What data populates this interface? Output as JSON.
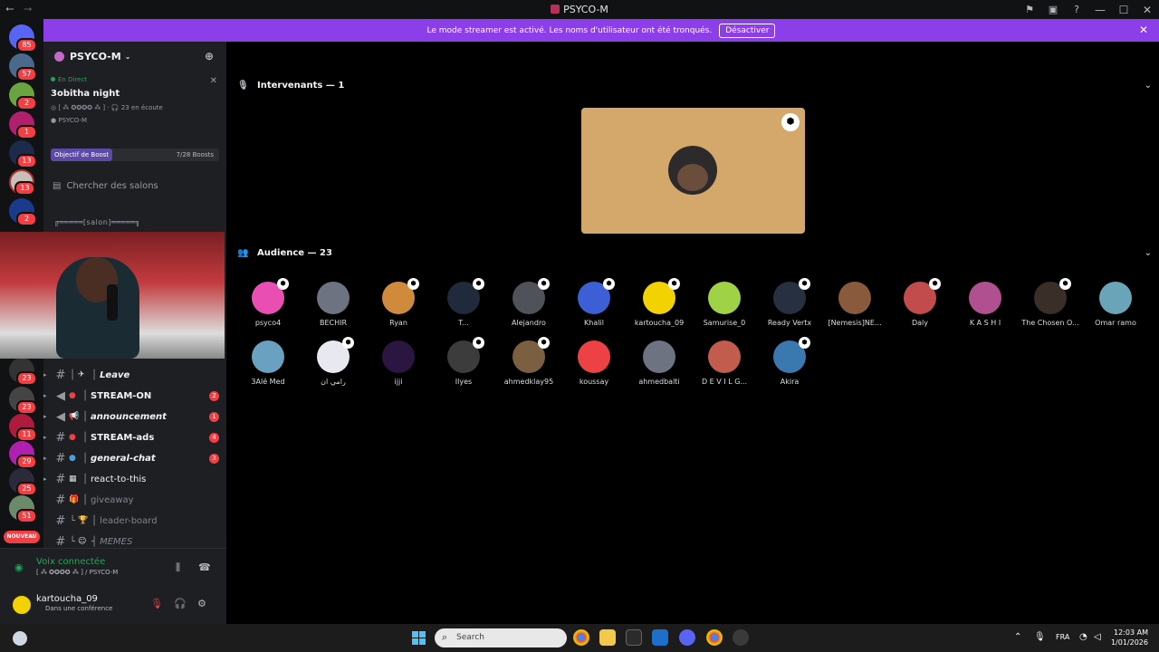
{
  "titlebar": {
    "title": "PSYCO-M",
    "back_icon": "arrow-left-icon",
    "forward_icon": "arrow-right-icon"
  },
  "streamer_banner": {
    "message": "Le mode streamer est activé. Les noms d'utilisateur ont été tronqués.",
    "button": "Désactiver"
  },
  "server_badges": [
    "85",
    "57",
    "2",
    "1",
    "13",
    "13",
    "2",
    "23",
    "23",
    "11",
    "29",
    "25",
    "51"
  ],
  "server_new_label": "NOUVEAU",
  "guild": {
    "name": "PSYCO-M",
    "live_label": "En Direct",
    "stage_title": "3obitha night",
    "stage_channel": "[ ⁂ ✪✪✪✪ ⁂ ]",
    "listeners": "23 en écoute",
    "host": "PSYCO-M",
    "boost_goal": "Objectif de Boost",
    "boost_count": "7/28 Boosts",
    "search_placeholder": "Chercher des salons",
    "category": "╔═════[salon]═════╗"
  },
  "channels": [
    {
      "emoji": "✈",
      "name": "Leave",
      "badge": "",
      "style": "bold-italic"
    },
    {
      "emoji": "●",
      "name": "STREAM-ON",
      "badge": "2",
      "style": "bold"
    },
    {
      "emoji": "📢",
      "name": "announcement",
      "badge": "1",
      "style": "italic"
    },
    {
      "emoji": "●",
      "name": "STREAM-ads",
      "badge": "4",
      "style": "bold"
    },
    {
      "emoji": "●",
      "name": "general-chat",
      "badge": "3",
      "style": "italic"
    },
    {
      "emoji": "▦",
      "name": "react-to-this",
      "badge": "",
      "style": "plain"
    },
    {
      "emoji": "🎁",
      "name": "giveaway",
      "badge": "",
      "style": "dim"
    },
    {
      "emoji": "🏆",
      "name": "leader-board",
      "badge": "",
      "style": "dim"
    },
    {
      "emoji": "☺",
      "name": "MEMES",
      "badge": "",
      "style": "dim"
    }
  ],
  "voice": {
    "status": "Voix connectée",
    "location": "[ ⁂ ✪✪✪✪ ⁂ ] / PSYCO-M"
  },
  "user": {
    "name": "kartoucha_09",
    "status": "Dans une conférence"
  },
  "stage": {
    "speakers_label": "Intervenants — 1",
    "audience_label": "Audience — 23"
  },
  "audience": [
    {
      "name": "psyco4",
      "color": "#e94fb3",
      "mod": true
    },
    {
      "name": "BECHIR",
      "color": "#6d7380",
      "mod": false
    },
    {
      "name": "Ryan",
      "color": "#d08a3c",
      "mod": true
    },
    {
      "name": "T...",
      "color": "#1f2a3c",
      "mod": true
    },
    {
      "name": "Alejandro",
      "color": "#4f5258",
      "mod": true
    },
    {
      "name": "Khalil",
      "color": "#3d5fd6",
      "mod": true
    },
    {
      "name": "kartoucha_09",
      "color": "#f2d200",
      "mod": true
    },
    {
      "name": "Samurise_0",
      "color": "#9fd245",
      "mod": false
    },
    {
      "name": "Ready Vertx",
      "color": "#263040",
      "mod": true
    },
    {
      "name": "[Nemesis]NE...",
      "color": "#8a5a3c",
      "mod": false
    },
    {
      "name": "Daly",
      "color": "#c24b4b",
      "mod": true
    },
    {
      "name": "K A S H I",
      "color": "#b05090",
      "mod": false
    },
    {
      "name": "The Chosen O...",
      "color": "#3a2e28",
      "mod": true
    },
    {
      "name": "Omar ramo",
      "color": "#6aa4b8",
      "mod": false
    },
    {
      "name": "3Alé Med",
      "color": "#6aa0c0",
      "mod": false
    },
    {
      "name": "رامي ان",
      "color": "#e8e8f0",
      "mod": true
    },
    {
      "name": "ijji",
      "color": "#2a1640",
      "mod": false
    },
    {
      "name": "Ilyes",
      "color": "#3c3c3c",
      "mod": true
    },
    {
      "name": "ahmedklay95",
      "color": "#7a6040",
      "mod": true
    },
    {
      "name": "koussay",
      "color": "#ed4245",
      "mod": false
    },
    {
      "name": "ahmedbalti",
      "color": "#6d7380",
      "mod": false
    },
    {
      "name": "D E V I L G...",
      "color": "#c25c4c",
      "mod": false
    },
    {
      "name": "Akira",
      "color": "#3a78b0",
      "mod": true
    }
  ],
  "taskbar": {
    "search_placeholder": "Search",
    "language": "FRA",
    "time": "12:03 AM",
    "date": "1/01/2026"
  }
}
